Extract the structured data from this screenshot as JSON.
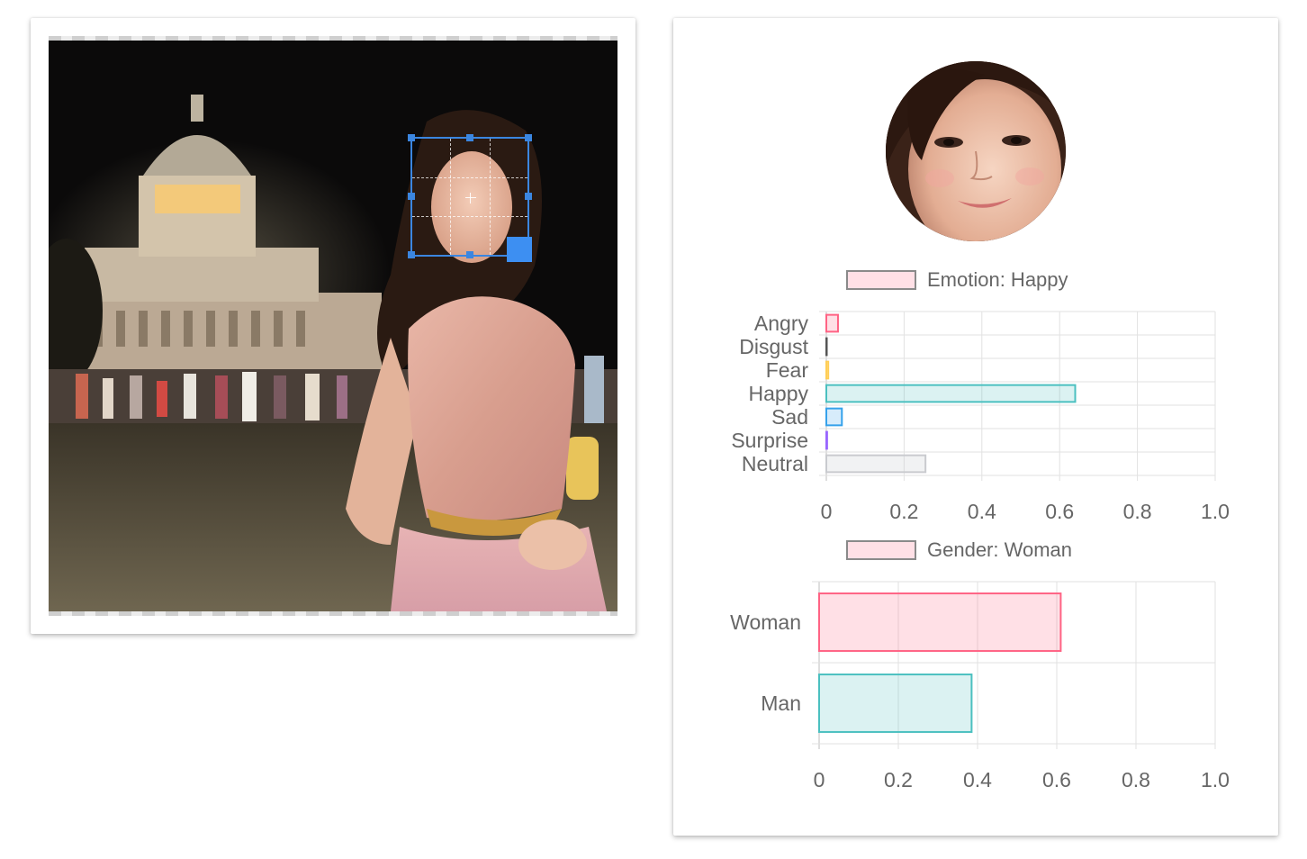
{
  "icons": {
    "crop_resize_handle": "square-resize-handle-icon",
    "crop_center": "crosshair-icon"
  },
  "colors": {
    "crop_border": "#3b86e0",
    "crop_handle": "#3d8ff2",
    "grid_line": "#e2e2e2",
    "text": "#666666"
  },
  "emotion_legend": {
    "label": "Emotion: Happy"
  },
  "gender_legend": {
    "label": "Gender: Woman"
  },
  "chart_data": [
    {
      "type": "bar",
      "orientation": "horizontal",
      "categories": [
        "Angry",
        "Disgust",
        "Fear",
        "Happy",
        "Sad",
        "Surprise",
        "Neutral"
      ],
      "series": [
        {
          "name": "Emotion: Happy",
          "values": [
            0.03,
            0.0,
            0.005,
            0.64,
            0.04,
            0.002,
            0.255
          ]
        }
      ],
      "colors": [
        {
          "fill": "rgba(255,99,132,0.2)",
          "stroke": "#ff6384"
        },
        {
          "fill": "rgba(75,75,75,0.1)",
          "stroke": "#555555"
        },
        {
          "fill": "rgba(255,206,86,0.2)",
          "stroke": "#ffce56"
        },
        {
          "fill": "rgba(75,192,192,0.2)",
          "stroke": "#4bc0c0"
        },
        {
          "fill": "rgba(54,162,235,0.2)",
          "stroke": "#36a2eb"
        },
        {
          "fill": "rgba(153,102,255,0.2)",
          "stroke": "#9966ff"
        },
        {
          "fill": "rgba(201,203,207,0.25)",
          "stroke": "#c9cbcf"
        }
      ],
      "xlim": [
        0,
        1.0
      ],
      "xticks": [
        "0",
        "0.2",
        "0.4",
        "0.6",
        "0.8",
        "1.0"
      ],
      "grid": true,
      "legend": "top"
    },
    {
      "type": "bar",
      "orientation": "horizontal",
      "categories": [
        "Woman",
        "Man"
      ],
      "series": [
        {
          "name": "Gender: Woman",
          "values": [
            0.61,
            0.385
          ]
        }
      ],
      "colors": [
        {
          "fill": "rgba(255,99,132,0.2)",
          "stroke": "#ff6384"
        },
        {
          "fill": "rgba(75,192,192,0.2)",
          "stroke": "#4bc0c0"
        }
      ],
      "xlim": [
        0,
        1.0
      ],
      "xticks": [
        "0",
        "0.2",
        "0.4",
        "0.6",
        "0.8",
        "1.0"
      ],
      "grid": true,
      "legend": "top"
    }
  ]
}
